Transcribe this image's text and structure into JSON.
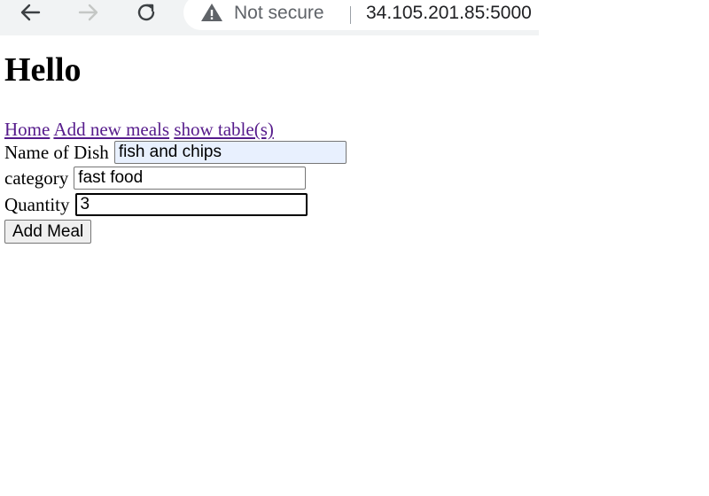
{
  "browser": {
    "security_status": "Not secure",
    "url": "34.105.201.85:5000",
    "icons": {
      "back": "back-arrow-icon",
      "forward": "forward-arrow-icon",
      "reload": "reload-icon",
      "warning": "warning-triangle-icon"
    }
  },
  "page": {
    "title": "Hello",
    "nav": {
      "home": "Home",
      "add_new_meals": "Add new meals",
      "show_tables": "show table(s)"
    },
    "form": {
      "dish_label": "Name of Dish",
      "dish_value": "fish and chips",
      "category_label": "category",
      "category_value": "fast food",
      "quantity_label": "Quantity",
      "quantity_value": "3",
      "submit_label": "Add Meal"
    }
  },
  "colors": {
    "link_visited": "#551a8b",
    "chrome_bg": "#f1f3f4",
    "autofill_bg": "#e8f0fe"
  }
}
